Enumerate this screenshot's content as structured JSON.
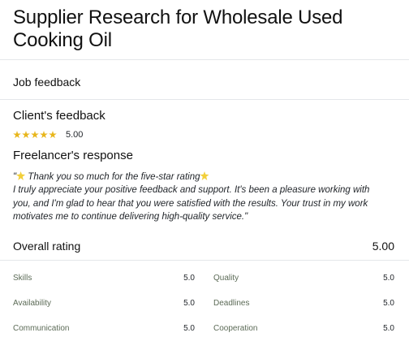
{
  "title": "Supplier Research for Wholesale Used Cooking Oil",
  "job_feedback_heading": "Job feedback",
  "client_feedback": {
    "heading": "Client's feedback",
    "stars": 5,
    "score": "5.00"
  },
  "freelancer_response": {
    "heading": "Freelancer's response",
    "line1_open": "\"",
    "line1_text": " Thank you so much for the five-star rating",
    "line2": "I truly appreciate your positive feedback and support. It's been a pleasure working with",
    "line3": "you, and I'm glad to hear that you were satisfied with the results. Your trust in my work",
    "line4": "motivates me to continue delivering high-quality service.\""
  },
  "overall": {
    "label": "Overall rating",
    "value": "5.00"
  },
  "metrics": [
    {
      "left_label": "Skills",
      "left_value": "5.0",
      "right_label": "Quality",
      "right_value": "5.0"
    },
    {
      "left_label": "Availability",
      "left_value": "5.0",
      "right_label": "Deadlines",
      "right_value": "5.0"
    },
    {
      "left_label": "Communication",
      "left_value": "5.0",
      "right_label": "Cooperation",
      "right_value": "5.0"
    }
  ],
  "colors": {
    "star": "#e8b61c",
    "sparkle": "#f2cf3a",
    "divider": "#e4e7ea"
  }
}
